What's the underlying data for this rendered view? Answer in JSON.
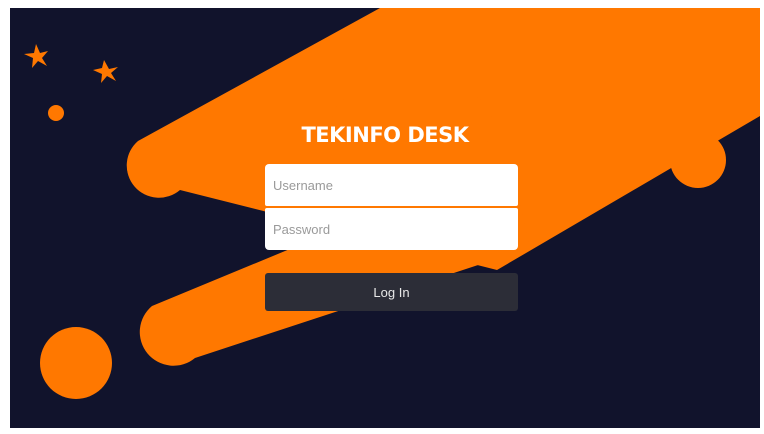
{
  "app": {
    "title": "TEKINFO DESK"
  },
  "login": {
    "username_placeholder": "Username",
    "password_placeholder": "Password",
    "submit_label": "Log In"
  },
  "colors": {
    "background": "#11132c",
    "accent": "#ff7800",
    "button": "#2c2d37",
    "field": "#ffffff"
  },
  "decorations": {
    "icons": [
      "star-icon",
      "star-icon",
      "dot-icon",
      "circle-icon"
    ]
  }
}
